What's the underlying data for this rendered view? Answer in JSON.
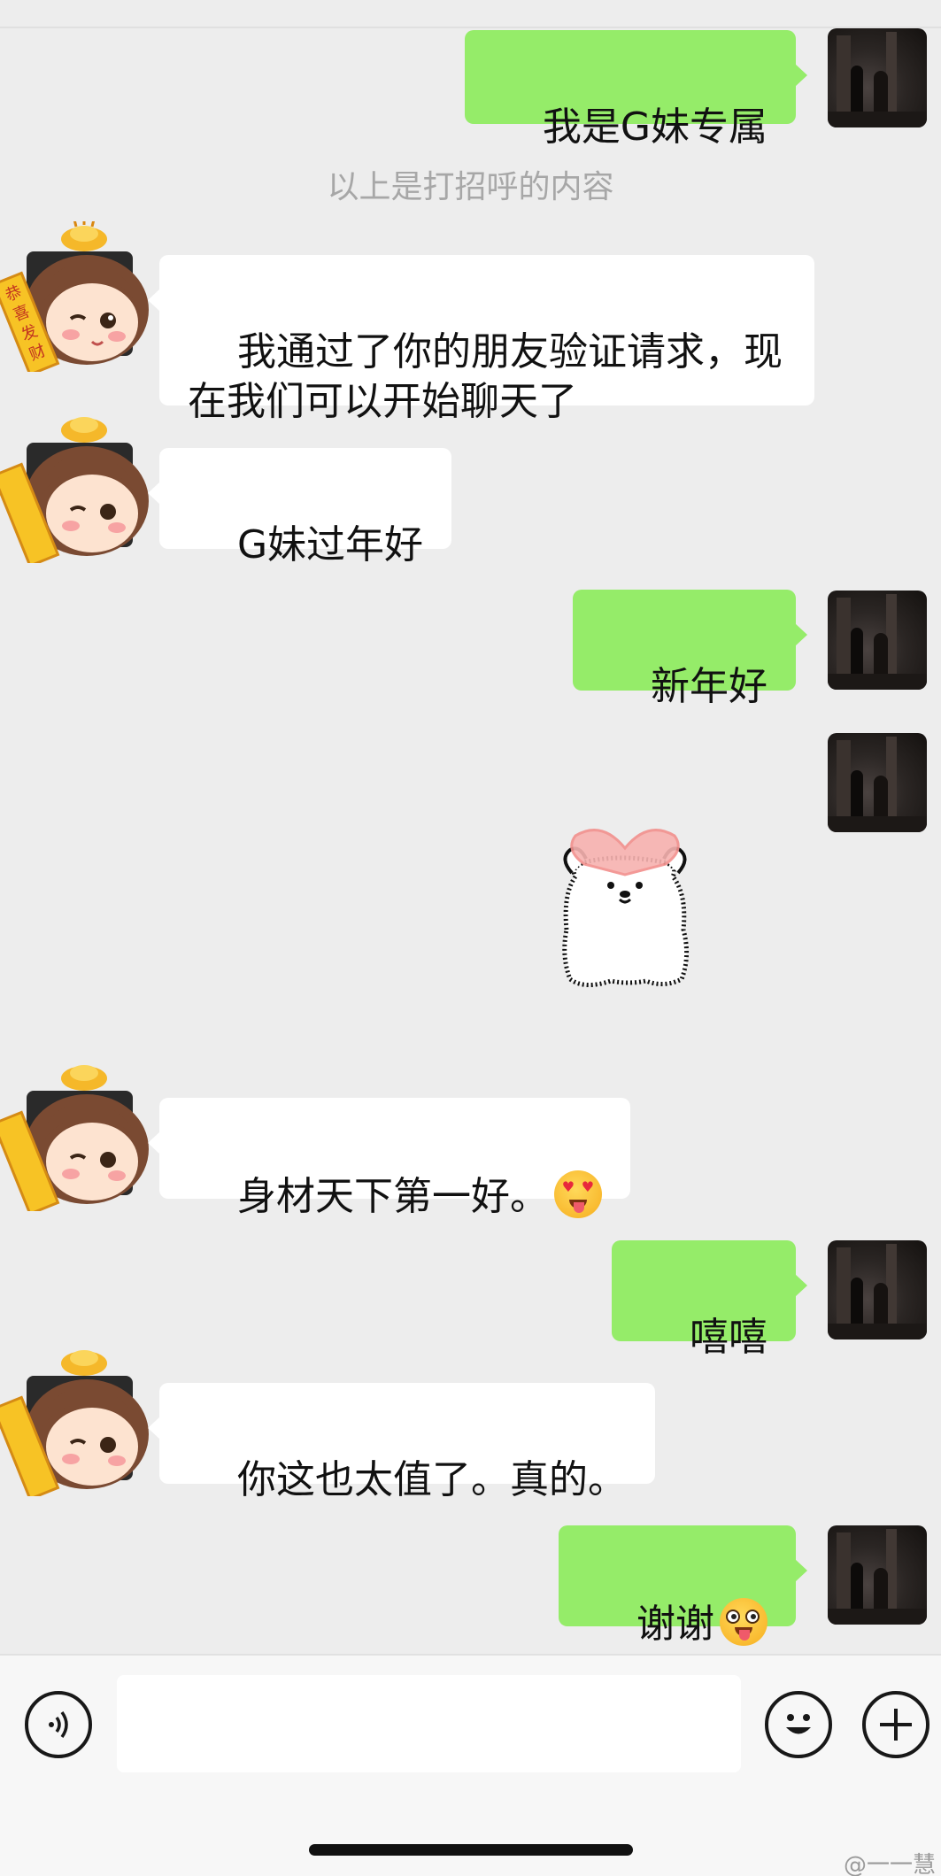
{
  "system_note": "以上是打招呼的内容",
  "messages": [
    {
      "side": "me",
      "type": "text",
      "text": "我是G妹专属"
    },
    {
      "side": "friend",
      "type": "text",
      "text": "我通过了你的朋友验证请求，现\n在我们可以开始聊天了"
    },
    {
      "side": "friend",
      "type": "text",
      "text": "G妹过年好"
    },
    {
      "side": "me",
      "type": "text",
      "text": "新年好"
    },
    {
      "side": "me",
      "type": "sticker",
      "sticker": "bear-holding-heart-sticker"
    },
    {
      "side": "friend",
      "type": "text",
      "text": "身材天下第一好。",
      "emoji": "heart-eyes-emoji"
    },
    {
      "side": "me",
      "type": "text",
      "text": "嘻嘻"
    },
    {
      "side": "friend",
      "type": "text",
      "text": "你这也太值了。真的。"
    },
    {
      "side": "me",
      "type": "text",
      "text": "谢谢",
      "emoji": "tongue-out-emoji"
    }
  ],
  "friend_avatar": {
    "scroll_text": "恭喜发财",
    "icon": "cartoon-boy-gold-ingot-avatar"
  },
  "input_bar": {
    "placeholder": "",
    "voice_icon": "voice-icon",
    "emoji_icon": "smiley-icon",
    "plus_icon": "plus-icon"
  },
  "watermark": "@一一慧",
  "colors": {
    "background": "#ededed",
    "my_bubble": "#95ec69",
    "friend_bubble": "#ffffff",
    "system_text": "#a7a7a7"
  }
}
